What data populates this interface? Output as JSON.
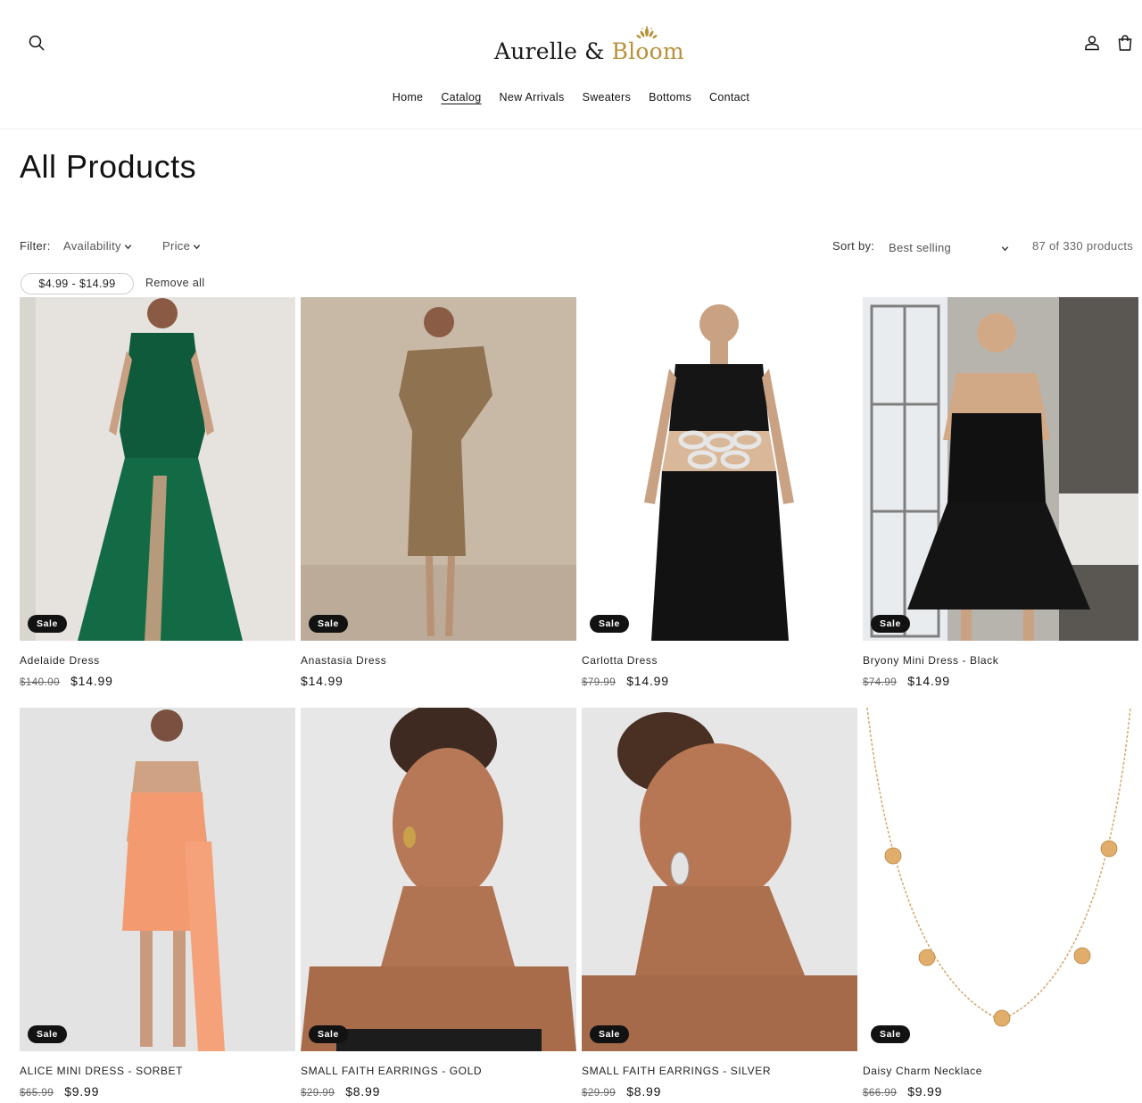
{
  "brand": {
    "part1": "Aurelle",
    "amp": "&",
    "part2": "Bloom",
    "accent": "#b8913a"
  },
  "icons": {
    "search": "search-icon",
    "account": "user-icon",
    "cart": "bag-icon"
  },
  "nav": [
    {
      "label": "Home",
      "active": false
    },
    {
      "label": "Catalog",
      "active": true
    },
    {
      "label": "New Arrivals",
      "active": false
    },
    {
      "label": "Sweaters",
      "active": false
    },
    {
      "label": "Bottoms",
      "active": false
    },
    {
      "label": "Contact",
      "active": false
    }
  ],
  "page_title": "All Products",
  "filters": {
    "label": "Filter:",
    "availability": "Availability",
    "price": "Price",
    "active_chip": "$4.99 - $14.99",
    "remove_all": "Remove all"
  },
  "sort": {
    "label": "Sort by:",
    "selected": "Best selling",
    "count": "87 of 330 products"
  },
  "products": [
    {
      "name": "Adelaide Dress",
      "old_price": "$140.00",
      "price": "$14.99",
      "badge": "Sale"
    },
    {
      "name": "Anastasia Dress",
      "old_price": "",
      "price": "$14.99",
      "badge": "Sale"
    },
    {
      "name": "Carlotta Dress",
      "old_price": "$79.99",
      "price": "$14.99",
      "badge": "Sale"
    },
    {
      "name": "Bryony Mini Dress - Black",
      "old_price": "$74.99",
      "price": "$14.99",
      "badge": "Sale"
    },
    {
      "name": "ALICE MINI DRESS - SORBET",
      "old_price": "$65.99",
      "price": "$9.99",
      "badge": "Sale"
    },
    {
      "name": "SMALL FAITH EARRINGS - GOLD",
      "old_price": "$29.99",
      "price": "$8.99",
      "badge": "Sale"
    },
    {
      "name": "SMALL FAITH EARRINGS - SILVER",
      "old_price": "$29.99",
      "price": "$8.99",
      "badge": "Sale"
    },
    {
      "name": "Daisy Charm Necklace",
      "old_price": "$66.99",
      "price": "$9.99",
      "badge": "Sale"
    }
  ]
}
